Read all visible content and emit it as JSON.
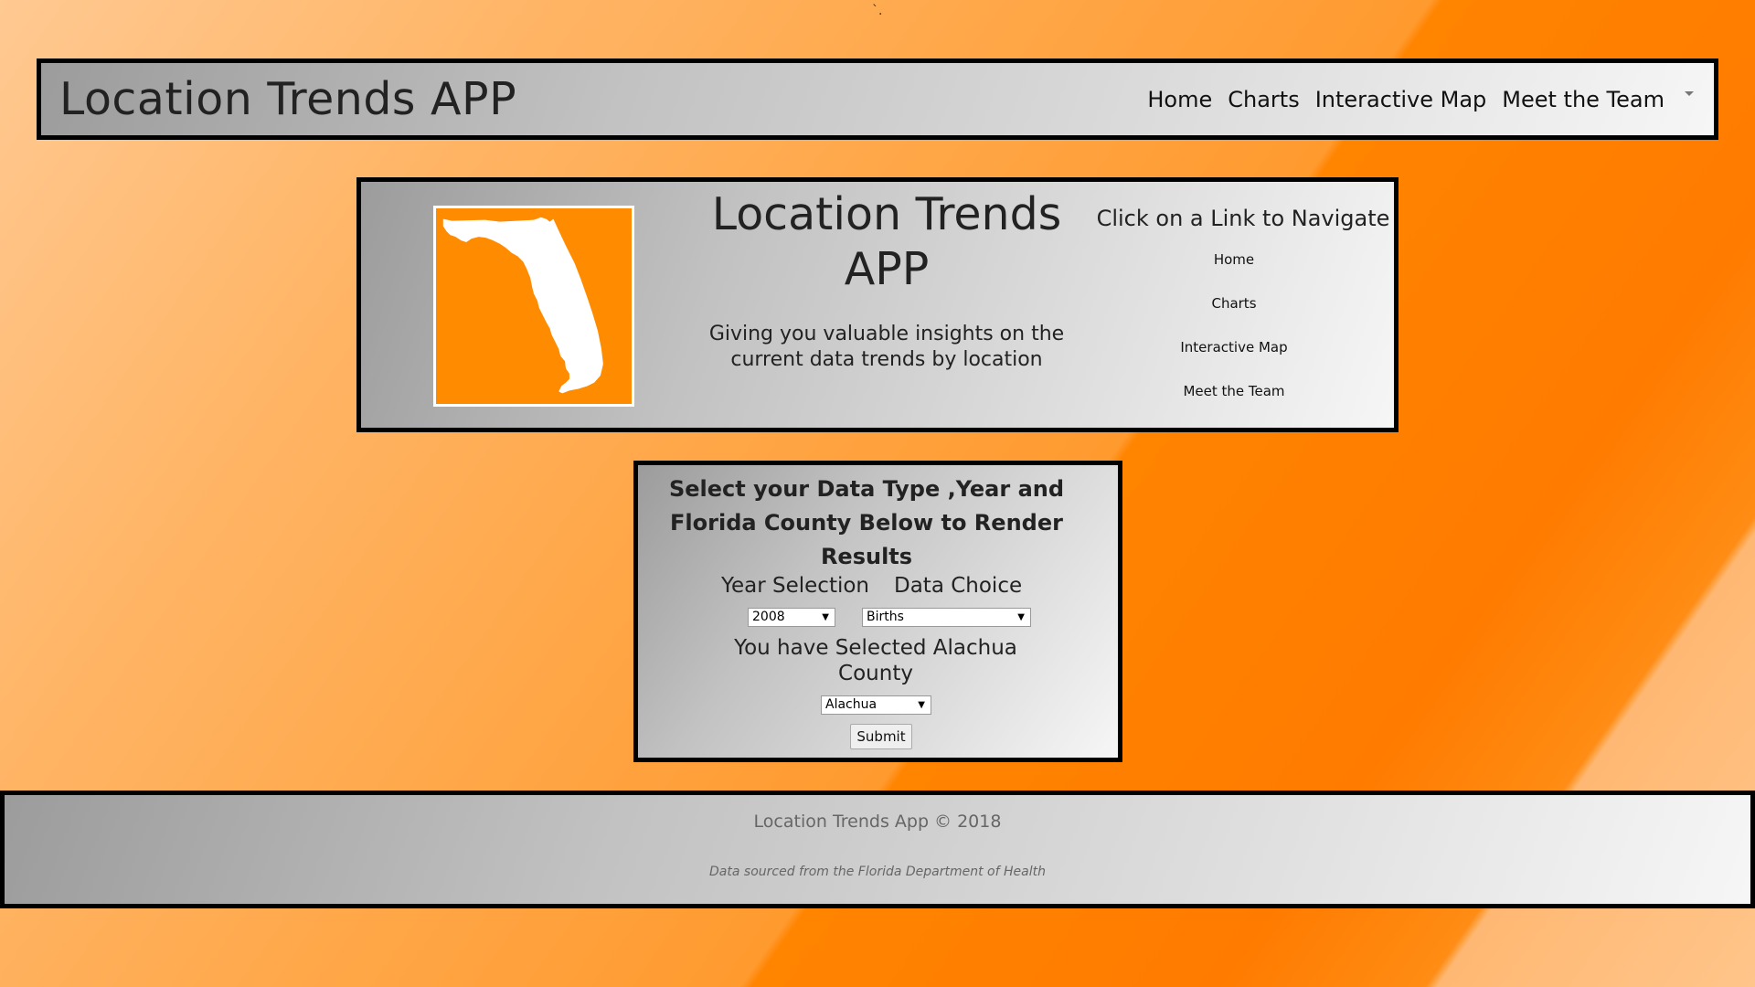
{
  "navbar": {
    "brand": "Location Trends APP",
    "links": [
      "Home",
      "Charts",
      "Interactive Map",
      "Meet the Team"
    ]
  },
  "hero": {
    "title": "Location Trends APP",
    "subtitle": "Giving you valuable insights on the current data trends by location",
    "nav_heading": "Click on a Link to Navigate",
    "nav_links": [
      "Home",
      "Charts",
      "Interactive Map",
      "Meet the Team"
    ],
    "logo_icon": "florida-map-icon",
    "logo_color": "#ff8c00"
  },
  "form": {
    "heading": "Select your Data Type ,Year and Florida County Below to Render Results",
    "year_label": "Year Selection",
    "data_label": "Data Choice",
    "year_value": "2008",
    "data_value": "Births",
    "county_message": "You have Selected Alachua County",
    "county_value": "Alachua",
    "submit_label": "Submit"
  },
  "footer": {
    "copyright": "Location Trends App © 2018",
    "source": "Data sourced from the Florida Department of Health"
  },
  "stray_mark": "`."
}
